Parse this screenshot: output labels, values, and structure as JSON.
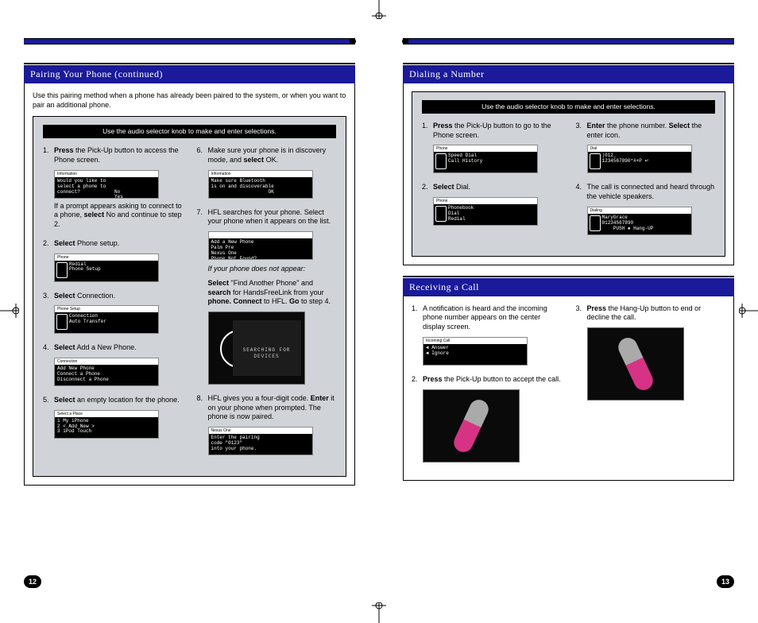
{
  "leftPage": {
    "number": "12",
    "section1": {
      "title": "Pairing Your Phone (continued)",
      "intro": "Use this pairing method when a phone has already been paired to the system, or when you want to pair an additional phone.",
      "hint": "Use the audio selector knob to make and enter selections.",
      "col1": {
        "step1": {
          "pre": "Press",
          "rest": " the Pick-Up button to access the Phone screen."
        },
        "step1b": {
          "pre": "If a prompt appears asking to connect to a phone, ",
          "bold": "select",
          "post": " No and continue to step 2."
        },
        "step2": {
          "pre": "Select",
          "rest": " Phone setup."
        },
        "step3": {
          "pre": "Select",
          "rest": " Connection."
        },
        "step4": {
          "pre": "Select",
          "rest": " Add a New Phone."
        },
        "step5": {
          "pre": "Select",
          "rest": " an empty location for the phone."
        },
        "screens": {
          "s1_top": "Information",
          "s1_body": "Would you like to\nselect a phone to\nconnect?            No\n                    Yes",
          "s2_top": "Phone",
          "s2_body": "Redial\nPhone Setup",
          "s3_top": "Phone Setup",
          "s3_body": "Connection\nAuto Transfer",
          "s4_top": "Connection",
          "s4_body": "Add New Phone\nConnect a Phone\nDisconnect a Phone",
          "s5_top": "Select a Place",
          "s5_body": "1 My iPhone\n2 < Add New >\n3 iPod Touch"
        }
      },
      "col2": {
        "step6": {
          "text": "Make sure your phone is in discovery mode, and ",
          "bold": "select",
          "post": " OK."
        },
        "step7": {
          "text": "HFL searches for your phone. Select your phone when it appears on the list."
        },
        "note": "If your phone does not appear:",
        "noteBody": {
          "a": "Select",
          "b": " \"Find Another Phone\" and ",
          "c": "search",
          "d": " for HandsFreeLink from your ",
          "e": "phone. Connect",
          "f": " to HFL. ",
          "g": "Go",
          "h": " to step 4."
        },
        "step8": {
          "text": "HFL gives you a four-digit code. ",
          "bold": "Enter",
          "post": " it on your phone when prompted. The phone is now paired."
        },
        "screens": {
          "s6_top": "Information",
          "s6_body": "Make sure Bluetooth\nis on and discoverable\n                    OK",
          "s7_top": "",
          "s7_body": "Add a New Phone\nPalm Pre\nNexus One\nPhone Not Found?",
          "searching": "SEARCHING\nFOR DEVICES",
          "s8_top": "Nexus One",
          "s8_body": "Enter the pairing\ncode \"0123\"\ninto your phone."
        }
      }
    }
  },
  "rightPage": {
    "number": "13",
    "section1": {
      "title": "Dialing a Number",
      "hint": "Use the audio selector knob to make and enter selections.",
      "col1": {
        "step1": {
          "pre": "Press",
          "rest": " the Pick-Up button to go to the Phone screen."
        },
        "step2": {
          "pre": "Select",
          "rest": " Dial."
        },
        "screens": {
          "s1_top": "Phone",
          "s1_body": "Speed Dial\nCall History",
          "s2_top": "Phone",
          "s2_body": "Phonebook\nDial\nRedial"
        }
      },
      "col2": {
        "step3": {
          "pre": "Enter",
          "rest": " the phone number. ",
          "bold2": "Select",
          "post": " the enter icon."
        },
        "step4": {
          "text": "The call is connected and heard through the vehicle speakers."
        },
        "screens": {
          "s3_top": "Dial",
          "s3_body": "|012_\n1234567890*#+P ↵",
          "s4_top": "Dialing",
          "s4_body": "MaryGrace\n01234567890\n    PUSH ● Hang-UP"
        }
      }
    },
    "section2": {
      "title": "Receiving a Call",
      "col1": {
        "step1": {
          "text": "A notification is heard and the incoming phone number appears on the center display screen."
        },
        "step2": {
          "pre": "Press",
          "rest": " the Pick-Up button to accept the call."
        },
        "screens": {
          "s1_top": "Incoming Call",
          "s1_body": "◄ Answer\n◄ Ignore"
        }
      },
      "col2": {
        "step3": {
          "pre": "Press",
          "rest": " the Hang-Up button to end or decline the call."
        }
      }
    }
  }
}
